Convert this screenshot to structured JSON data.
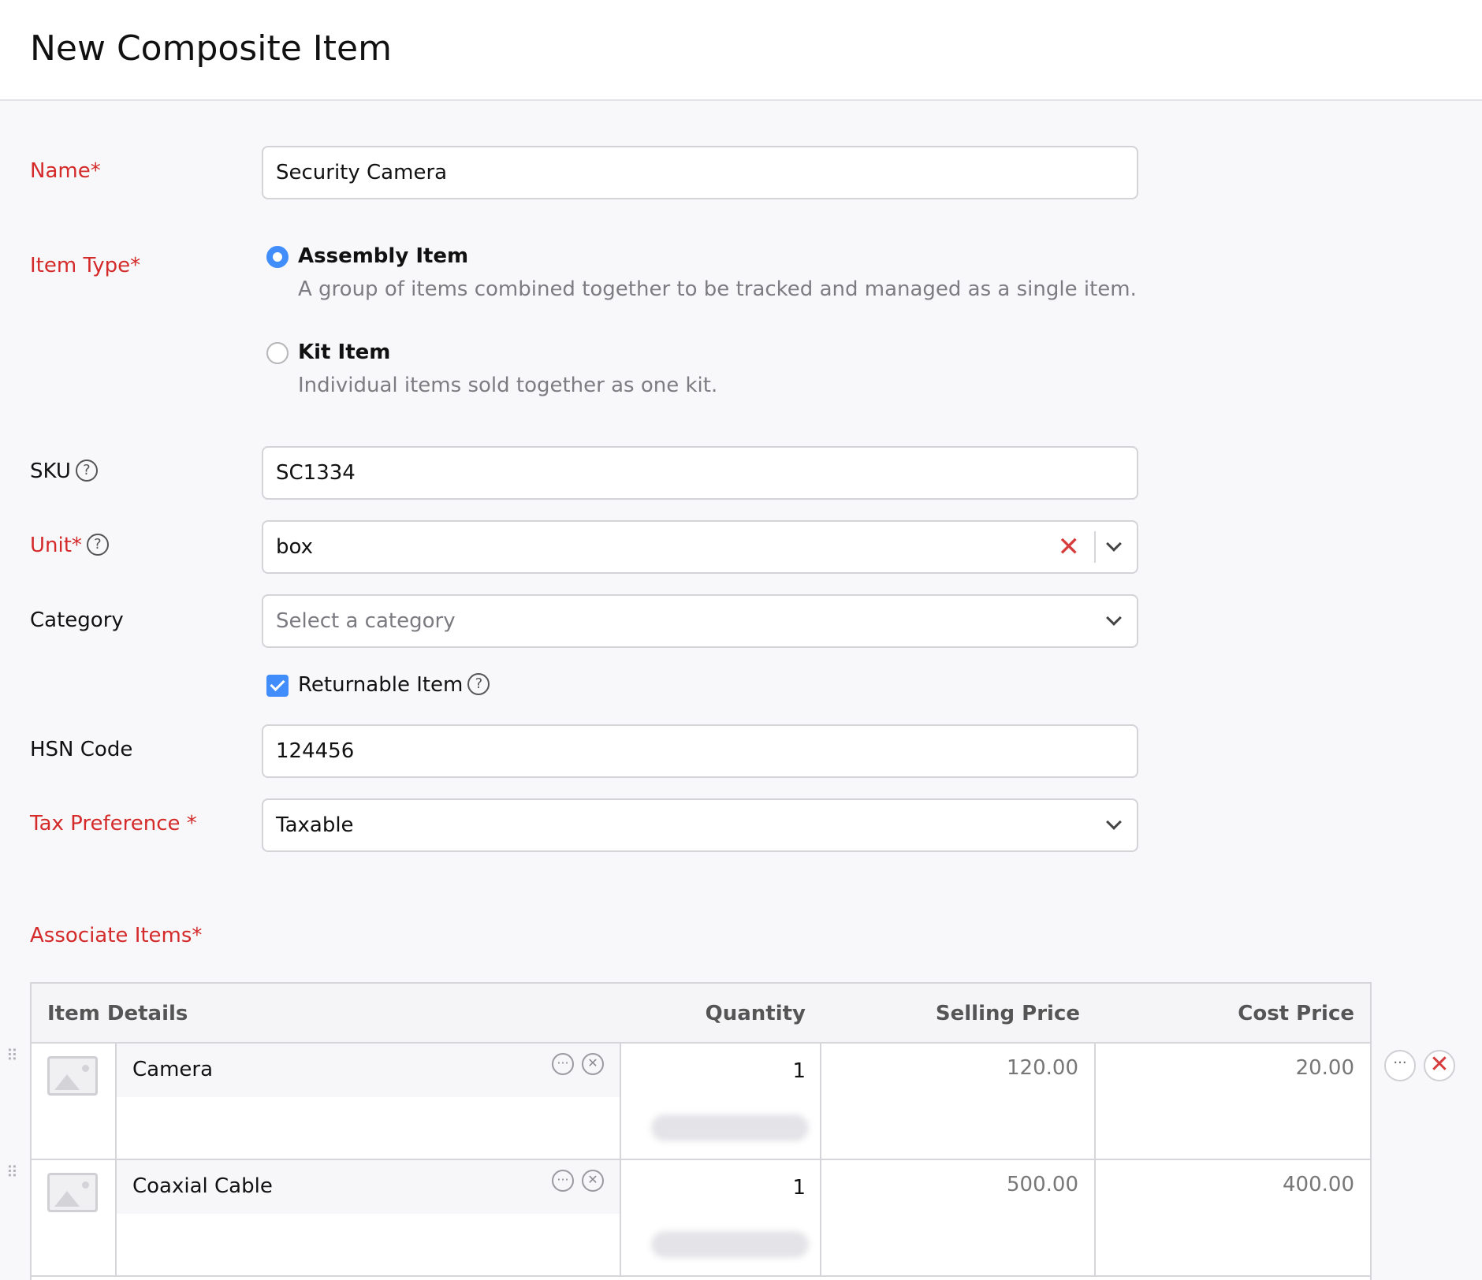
{
  "header": {
    "title": "New Composite Item"
  },
  "form": {
    "name": {
      "label": "Name*",
      "value": "Security Camera"
    },
    "item_type": {
      "label": "Item Type*",
      "options": [
        {
          "title": "Assembly Item",
          "description": "A group of items combined together to be tracked and managed as a single item.",
          "selected": true
        },
        {
          "title": "Kit Item",
          "description": "Individual items sold together as one kit.",
          "selected": false
        }
      ]
    },
    "sku": {
      "label": "SKU",
      "value": "SC1334",
      "help_icon": "question-circle-icon"
    },
    "unit": {
      "label": "Unit*",
      "value": "box",
      "help_icon": "question-circle-icon",
      "clear_icon": "close-icon"
    },
    "category": {
      "label": "Category",
      "placeholder": "Select a category"
    },
    "returnable": {
      "label": "Returnable Item",
      "checked": true
    },
    "hsn_code": {
      "label": "HSN Code",
      "value": "124456"
    },
    "tax_preference": {
      "label": "Tax Preference *",
      "value": "Taxable"
    }
  },
  "associate_items": {
    "heading": "Associate Items*",
    "columns": [
      "Item Details",
      "Quantity",
      "Selling Price",
      "Cost Price"
    ],
    "rows": [
      {
        "name": "Camera",
        "quantity": "1",
        "selling_price": "120.00",
        "cost_price": "20.00"
      },
      {
        "name": "Coaxial Cable",
        "quantity": "1",
        "selling_price": "500.00",
        "cost_price": "400.00"
      }
    ]
  },
  "colors": {
    "required": "#d42a2a",
    "accent": "#408dfb",
    "delete": "#d63c3c"
  }
}
